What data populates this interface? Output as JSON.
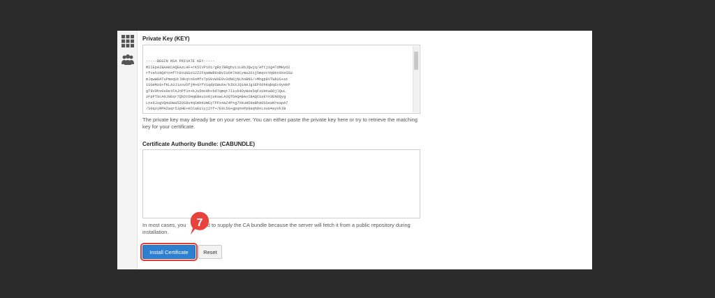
{
  "private_key": {
    "label": "Private Key (KEY)",
    "value": "-----BEGIN RSA PRIVATE KEY-----\nMIIEpAIBAAKCAQEAzLHF+rK5IVP1O1/gRz7BRghvi1L8bJQwjq/AftjXg4TdMHyO2\nrfvahiNQ9Yo4fTt8tUGUzS2Z2FqaNWR9xBvIUO47A9Cyma2O1j5mqVcVq9Kx0XeSGU\nmJqwW8ATuPmeqUtlNkqtn6oMfxTpS0vWXE0v3dN6jNLhoBNS/+Mhgp8VTWkUS+at\n1SGHMz8+fKLA3J1znvDfjM+GYfV1qdpSWuke/bIKXJQiAHJg1EF60hKqbqEc0yHkP\ngT9V9hv0s8etFAJnPf1n+kJu5mcHh+bd7qmqt7Iiuk4OyWoe5qFxUHna8OjlQuL\nzFpPT0cA9JGEqr7QkDtOHqEBeu1o0juKswLA3QTDAQABAoIBAQCUxEYn3EN0Qyg\nLns9JugVQmibWa5Z0S8u4qCmbKUmEyTPFx4aZ4P+g7XKuHD9eBhA0GSeaNYeapA7\n/S0qzyRPHZaqr5JpHE+KCCaEU1yj2Yf+/E9L5G+gpqnnPp9aqh0nLouU4ayVkIB\nW2HMNQ5txFy7nMsKXAnucvu7Wt9zrudV+2O62qqlzpNbQWsMhgNzWIMk3r1NE20\noVJ4jrYsDqB6GDXk1VR2MuNJsKXnE163kj4j3SQyQyz0b7YOv6ueeCvhscuTIqyf"
  },
  "private_key_help": "The private key may already be on your server. You can either paste the private key here or try to retrieve the matching key for your certificate.",
  "ca_bundle": {
    "label": "Certificate Authority Bundle: (CABUNDLE)",
    "value": ""
  },
  "ca_help_before": "In most cases, you",
  "ca_help_after": "ed to supply the CA bundle because the server will fetch it from a public repository during installation.",
  "buttons": {
    "install": "Install Certificate",
    "reset": "Reset"
  },
  "step_badge": "7",
  "colors": {
    "primary": "#2f7fd1",
    "highlight": "#e03a3a"
  },
  "icons": {
    "sidebar_top": "grid-icon",
    "sidebar_bottom": "users-icon"
  }
}
